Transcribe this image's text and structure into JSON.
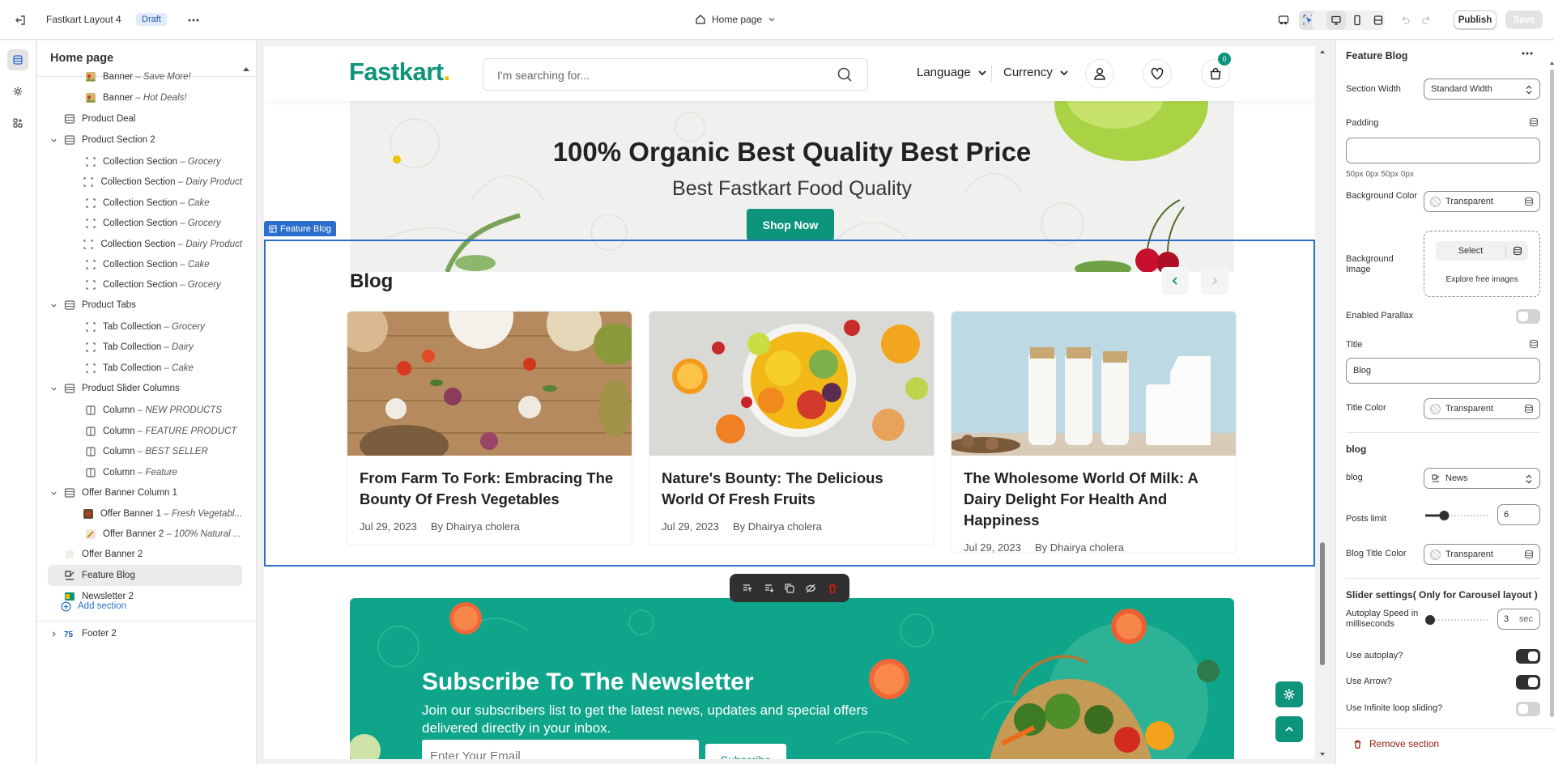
{
  "topbar": {
    "store_name": "Fastkart Layout 4",
    "status_badge": "Draft",
    "page_selector": "Home page",
    "publish_label": "Publish",
    "save_label": "Save"
  },
  "sidebar": {
    "title": "Home page",
    "items": [
      {
        "label": "Banner",
        "suffix": "Save More!"
      },
      {
        "label": "Banner",
        "suffix": "Hot Deals!"
      },
      {
        "label": "Product Deal",
        "suffix": ""
      },
      {
        "label": "Product Section 2",
        "suffix": ""
      },
      {
        "label": "Collection Section",
        "suffix": "Grocery"
      },
      {
        "label": "Collection Section",
        "suffix": "Dairy Product"
      },
      {
        "label": "Collection Section",
        "suffix": "Cake"
      },
      {
        "label": "Collection Section",
        "suffix": "Grocery"
      },
      {
        "label": "Collection Section",
        "suffix": "Dairy Product"
      },
      {
        "label": "Collection Section",
        "suffix": "Cake"
      },
      {
        "label": "Collection Section",
        "suffix": "Grocery"
      },
      {
        "label": "Product Tabs",
        "suffix": ""
      },
      {
        "label": "Tab Collection",
        "suffix": "Grocery"
      },
      {
        "label": "Tab Collection",
        "suffix": "Dairy"
      },
      {
        "label": "Tab Collection",
        "suffix": "Cake"
      },
      {
        "label": "Product Slider Columns",
        "suffix": ""
      },
      {
        "label": "Column",
        "suffix": "NEW PRODUCTS"
      },
      {
        "label": "Column",
        "suffix": "FEATURE PRODUCT"
      },
      {
        "label": "Column",
        "suffix": "BEST SELLER"
      },
      {
        "label": "Column",
        "suffix": "Feature"
      },
      {
        "label": "Offer Banner Column 1",
        "suffix": ""
      },
      {
        "label": "Offer Banner 1",
        "suffix": "Fresh Vegetabl..."
      },
      {
        "label": "Offer Banner 2",
        "suffix": "100% Natural ..."
      },
      {
        "label": "Offer Banner 2",
        "suffix": ""
      },
      {
        "label": "Feature Blog",
        "suffix": ""
      },
      {
        "label": "Newsletter 2",
        "suffix": ""
      }
    ],
    "add_section": "Add section",
    "footer": "Footer 2"
  },
  "preview": {
    "logo": "Fastkart",
    "logo_dot": ".",
    "search_placeholder": "I'm searching for...",
    "language": "Language",
    "currency": "Currency",
    "cart_count": "0",
    "hero_title": "100% Organic Best Quality Best Price",
    "hero_subtitle": "Best Fastkart Food Quality",
    "hero_button": "Shop Now",
    "selected_label": "Feature Blog",
    "blog_heading": "Blog",
    "posts": [
      {
        "title": "From Farm To Fork: Embracing The Bounty Of Fresh Vegetables",
        "date": "Jul 29, 2023",
        "author": "By Dhairya cholera"
      },
      {
        "title": "Nature's Bounty: The Delicious World Of Fresh Fruits",
        "date": "Jul 29, 2023",
        "author": "By Dhairya cholera"
      },
      {
        "title": "The Wholesome World Of Milk: A Dairy Delight For Health And Happiness",
        "date": "Jul 29, 2023",
        "author": "By Dhairya cholera"
      }
    ],
    "newsletter_title": "Subscribe To The Newsletter",
    "newsletter_text": "Join our subscribers list to get the latest news, updates and special offers delivered directly in your inbox.",
    "newsletter_placeholder": "Enter Your Email",
    "newsletter_button": "Subscribe"
  },
  "panel": {
    "title": "Feature Blog",
    "section_width_label": "Section Width",
    "section_width_value": "Standard Width",
    "padding_label": "Padding",
    "padding_value": "",
    "padding_hint": "50px 0px 50px 0px",
    "bg_color_label": "Background Color",
    "bg_color_value": "Transparent",
    "bg_image_label": "Background Image",
    "bg_image_select": "Select",
    "bg_image_explore": "Explore free images",
    "parallax_label": "Enabled Parallax",
    "title_label": "Title",
    "title_value": "Blog",
    "title_color_label": "Title Color",
    "title_color_value": "Transparent",
    "blog_section": "blog",
    "blog_label": "blog",
    "blog_value": "News",
    "posts_limit_label": "Posts limit",
    "posts_limit_value": "6",
    "posts_limit_fraction": 0.3,
    "blog_title_color_label": "Blog Title Color",
    "blog_title_color_value": "Transparent",
    "slider_section": "Slider settings( Only for Carousel layout )",
    "autoplay_speed_label": "Autoplay Speed in milliseconds",
    "autoplay_speed_value": "3",
    "autoplay_speed_unit": "sec",
    "use_autoplay_label": "Use autoplay?",
    "use_arrow_label": "Use Arrow?",
    "infinite_label": "Use Infinite loop sliding?",
    "remove_label": "Remove section"
  },
  "colors": {
    "brand": "#0e947a",
    "selection": "#2c6ecb",
    "remove": "#8e1f0b"
  }
}
